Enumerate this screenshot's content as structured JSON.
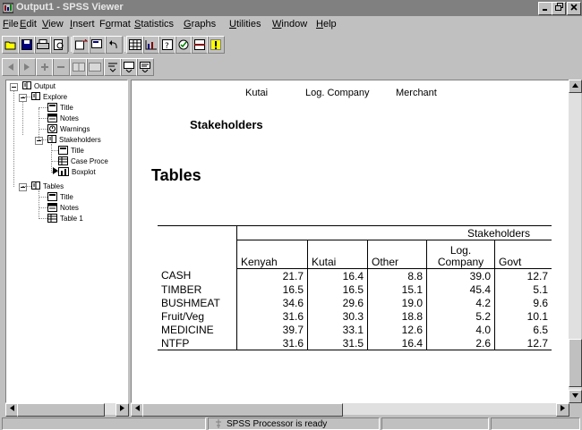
{
  "window": {
    "title": "Output1 - SPSS Viewer"
  },
  "menu": [
    {
      "label": "File",
      "ul": "F",
      "rest": "ile"
    },
    {
      "label": "Edit",
      "ul": "E",
      "rest": "dit"
    },
    {
      "label": "View",
      "ul": "V",
      "rest": "iew"
    },
    {
      "label": "Insert",
      "ul": "I",
      "rest": "nsert"
    },
    {
      "label": "Format",
      "ul": "o",
      "pre": "F",
      "rest": "rmat"
    },
    {
      "label": "Statistics",
      "ul": "S",
      "rest": "tatistics"
    },
    {
      "label": "Graphs",
      "ul": "G",
      "rest": "raphs"
    },
    {
      "label": "Utilities",
      "ul": "U",
      "rest": "tilities"
    },
    {
      "label": "Window",
      "ul": "W",
      "rest": "indow"
    },
    {
      "label": "Help",
      "ul": "H",
      "rest": "elp"
    }
  ],
  "outline": {
    "root": "Output",
    "explore": "Explore",
    "explore_children": [
      "Title",
      "Notes",
      "Warnings"
    ],
    "stakeholders": "Stakeholders",
    "stakeholders_children": [
      "Title",
      "Case Proce",
      "Boxplot"
    ],
    "tables": "Tables",
    "tables_children": [
      "Title",
      "Notes",
      "Table 1"
    ]
  },
  "content": {
    "header_labels": [
      "Kutai",
      "Log. Company",
      "Merchant"
    ],
    "stakeholders_title": "Stakeholders",
    "tables_title": "Tables",
    "pivot": {
      "group_header": "Stakeholders",
      "columns": [
        "Kenyah",
        "Kutai",
        "Other",
        "Log. Company",
        "Govt"
      ],
      "rows": [
        {
          "label": "CASH",
          "values": [
            "21.7",
            "16.4",
            "8.8",
            "39.0",
            "12.7"
          ]
        },
        {
          "label": "TIMBER",
          "values": [
            "16.5",
            "16.5",
            "15.1",
            "45.4",
            "5.1"
          ]
        },
        {
          "label": "BUSHMEAT",
          "values": [
            "34.6",
            "29.6",
            "19.0",
            "4.2",
            "9.6"
          ]
        },
        {
          "label": "Fruit/Veg",
          "values": [
            "31.6",
            "30.3",
            "18.8",
            "5.2",
            "10.1"
          ]
        },
        {
          "label": "MEDICINE",
          "values": [
            "39.7",
            "33.1",
            "12.6",
            "4.0",
            "6.5"
          ]
        },
        {
          "label": "NTFP",
          "values": [
            "31.6",
            "31.5",
            "16.4",
            "2.6",
            "12.7"
          ]
        }
      ]
    }
  },
  "status": {
    "processor": "SPSS Processor  is ready"
  }
}
